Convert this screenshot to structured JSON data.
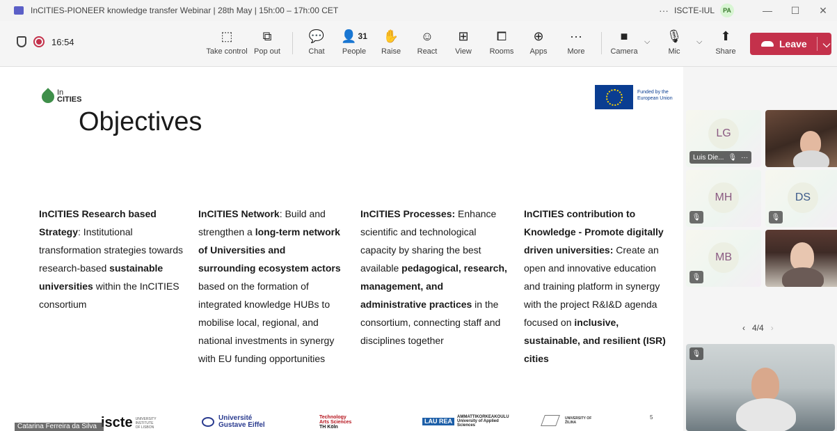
{
  "window": {
    "title": "InCITIES-PIONEER knowledge transfer Webinar | 28th May | 15h:00 – 17h:00 CET",
    "more": "···",
    "org": "ISCTE-IUL",
    "user_initials": "PA",
    "minimize": "—",
    "maximize": "☐",
    "close": "✕"
  },
  "toolbar": {
    "time": "16:54",
    "buttons": [
      {
        "label": "Take control",
        "icon": "take-control-icon",
        "glyph": "⬚"
      },
      {
        "label": "Pop out",
        "icon": "pop-out-icon",
        "glyph": "⧉"
      },
      {
        "label": "Chat",
        "icon": "chat-icon",
        "glyph": "💬"
      },
      {
        "label": "People",
        "icon": "people-icon",
        "glyph": "👤",
        "count": "31"
      },
      {
        "label": "Raise",
        "icon": "raise-hand-icon",
        "glyph": "✋"
      },
      {
        "label": "React",
        "icon": "react-icon",
        "glyph": "☺"
      },
      {
        "label": "View",
        "icon": "view-icon",
        "glyph": "⊞"
      },
      {
        "label": "Rooms",
        "icon": "rooms-icon",
        "glyph": "⧠"
      },
      {
        "label": "Apps",
        "icon": "apps-icon",
        "glyph": "⊕"
      },
      {
        "label": "More",
        "icon": "more-icon",
        "glyph": "···"
      },
      {
        "label": "Camera",
        "icon": "camera-icon",
        "glyph": "■"
      },
      {
        "label": "Mic",
        "icon": "mic-muted-icon",
        "glyph": "🎙"
      },
      {
        "label": "Share",
        "icon": "share-icon",
        "glyph": "⬆"
      }
    ],
    "leave_label": "Leave",
    "chevron": "⌵"
  },
  "slide": {
    "logo_top": "In",
    "logo_bottom": "CITIES",
    "title": "Objectives",
    "eu_text_1": "Funded by the",
    "eu_text_2": "European Union",
    "columns": [
      [
        {
          "t": "InCITIES Research based Strategy",
          "b": true
        },
        {
          "t": ": Institutional transformation strategies towards research-based ",
          "b": false
        },
        {
          "t": "sustainable universities",
          "b": true
        },
        {
          "t": " within the InCITIES consortium",
          "b": false
        }
      ],
      [
        {
          "t": "InCITIES Network",
          "b": true
        },
        {
          "t": ": Build and strengthen a ",
          "b": false
        },
        {
          "t": "long-term network of Universities and surrounding ecosystem actors",
          "b": true
        },
        {
          "t": " based on the formation of integrated knowledge HUBs to mobilise local, regional, and national investments in synergy with EU funding opportunities",
          "b": false
        }
      ],
      [
        {
          "t": "InCITIES Processes:",
          "b": true
        },
        {
          "t": " Enhance scientific and technological capacity by sharing the best available ",
          "b": false
        },
        {
          "t": "pedagogical, research, management, and administrative practices",
          "b": true
        },
        {
          "t": " in the consortium, connecting staff and disciplines together",
          "b": false
        }
      ],
      [
        {
          "t": "InCITIES contribution to Knowledge - Promote digitally driven universities:",
          "b": true
        },
        {
          "t": " Create an open and innovative education and training platform in synergy with the project R&I&D agenda focused on ",
          "b": false
        },
        {
          "t": "inclusive, sustainable, and resilient (ISR) cities",
          "b": true
        }
      ]
    ],
    "page_number": "5",
    "footer": {
      "iscte": "iscte",
      "iscte_sub": "UNIVERSITY INSTITUTE OF LISBON",
      "ugf_1": "Université",
      "ugf_2": "Gustave Eiffel",
      "th_1": "Technology",
      "th_2": "Arts Sciences",
      "th_3": "TH Köln",
      "laurea_box": "LAU REA",
      "laurea_text": "AMMATTIKORKEAKOULU University of Applied Sciences",
      "zilina": "UNIVERSITY OF ŽILINA"
    },
    "presenter_name": "Catarina Ferreira da Silva"
  },
  "gallery": {
    "tiles": [
      {
        "initials": "LG",
        "name": "Luis Die...",
        "menu": "···"
      },
      {
        "initials": "MH"
      },
      {
        "initials": "DS"
      },
      {
        "initials": "MB"
      }
    ],
    "pager_prev": "‹",
    "pager_text": "4/4",
    "pager_next": "›"
  },
  "colors": {
    "leave": "#c4314b",
    "recording": "#c4314b",
    "eu_blue": "#0a3d91"
  }
}
